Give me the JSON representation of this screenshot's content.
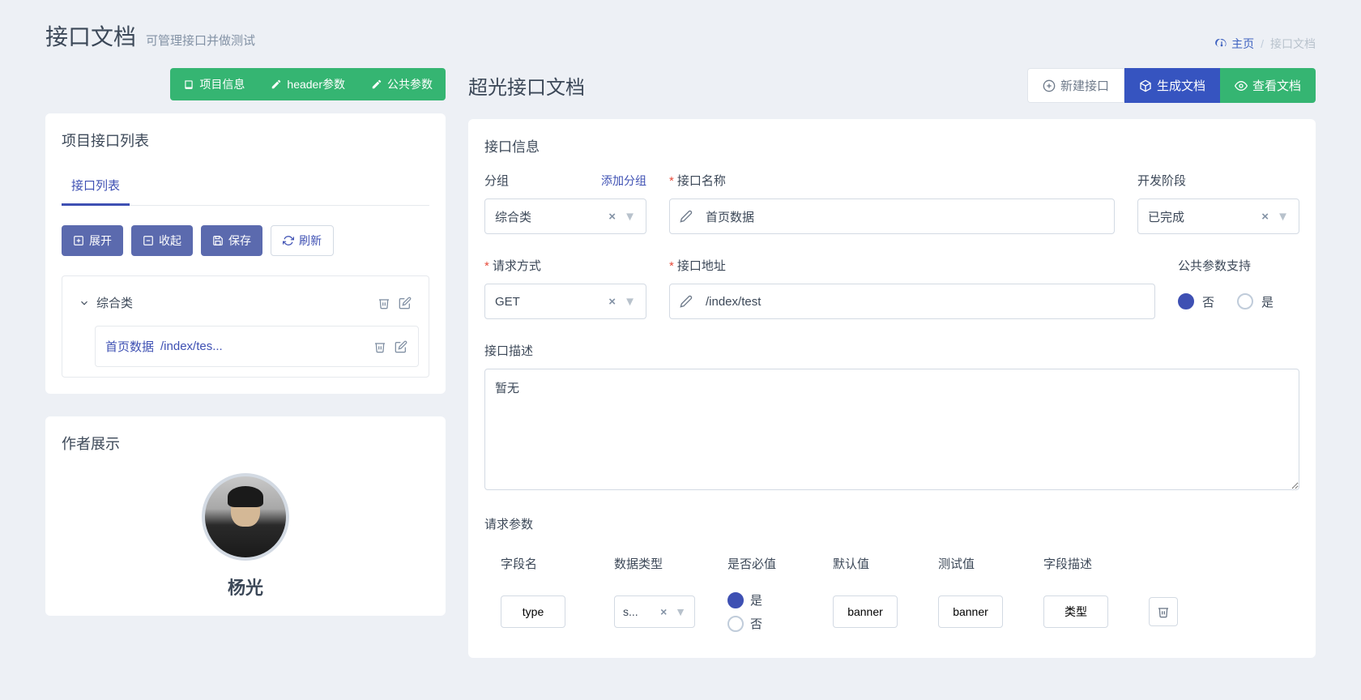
{
  "page": {
    "title": "接口文档",
    "subtitle": "可管理接口并做测试"
  },
  "breadcrumb": {
    "home": "主页",
    "current": "接口文档"
  },
  "topActions": {
    "projectInfo": "项目信息",
    "headerParams": "header参数",
    "publicParams": "公共参数"
  },
  "sidebar": {
    "list_card_title": "项目接口列表",
    "tab_label": "接口列表",
    "treeActions": {
      "expand": "展开",
      "collapse": "收起",
      "save": "保存",
      "refresh": "刷新"
    },
    "tree": {
      "group_label": "综合类",
      "item_name": "首页数据",
      "item_url": "/index/tes..."
    },
    "author_card_title": "作者展示",
    "author_name": "杨光"
  },
  "main": {
    "title": "超光接口文档",
    "actions": {
      "new": "新建接口",
      "generate": "生成文档",
      "view": "查看文档"
    },
    "section_info": "接口信息",
    "labels": {
      "group": "分组",
      "add_group": "添加分组",
      "name": "接口名称",
      "stage": "开发阶段",
      "method": "请求方式",
      "url": "接口地址",
      "public_params": "公共参数支持",
      "desc": "接口描述",
      "request_params": "请求参数"
    },
    "values": {
      "group": "综合类",
      "name": "首页数据",
      "stage": "已完成",
      "method": "GET",
      "url": "/index/test",
      "desc": "暂无"
    },
    "radio": {
      "no": "否",
      "yes": "是"
    },
    "paramHeaders": {
      "field": "字段名",
      "type": "数据类型",
      "required": "是否必值",
      "default": "默认值",
      "test": "测试值",
      "desc": "字段描述"
    },
    "paramRow": {
      "field": "type",
      "type": "s...",
      "default": "banner",
      "test": "banner",
      "desc": "类型"
    }
  }
}
